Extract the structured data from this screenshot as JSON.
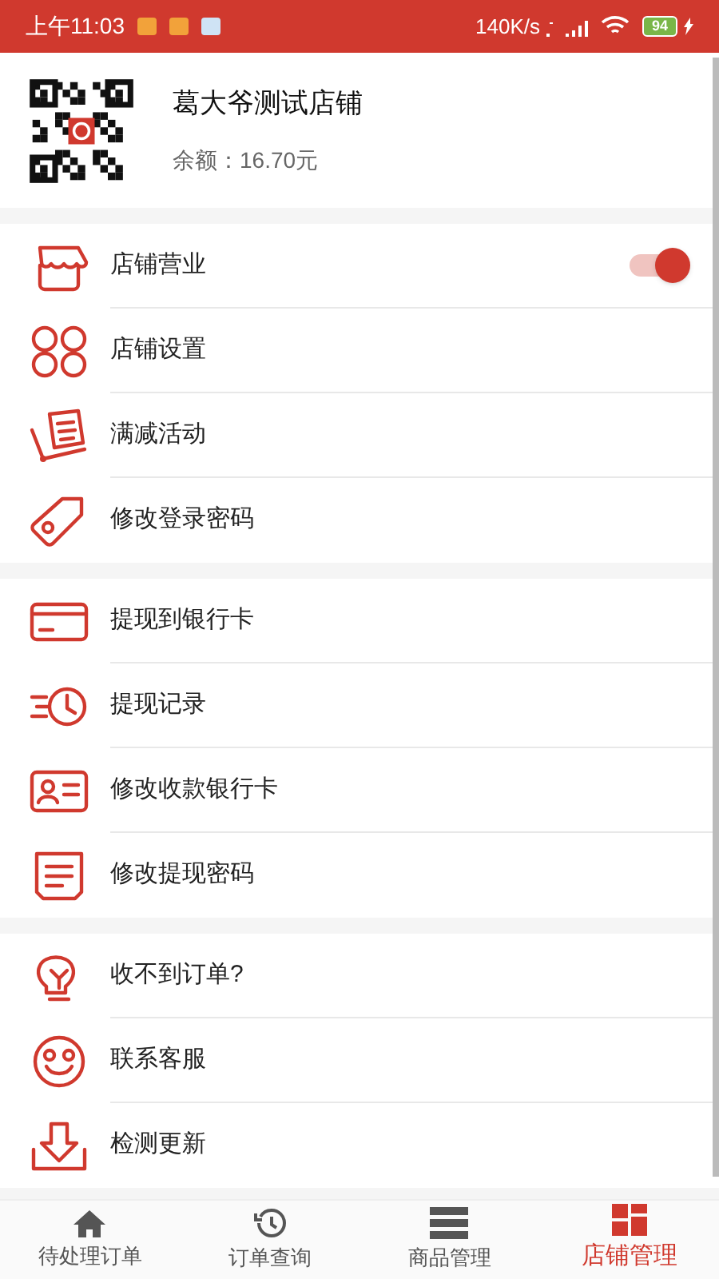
{
  "status_bar": {
    "time": "上午11:03",
    "speed": "140K/s",
    "battery": "94"
  },
  "shop": {
    "name": "葛大爷测试店铺",
    "balance": "余额：16.70元"
  },
  "groups": [
    {
      "items": [
        {
          "label": "店铺营业",
          "kind": "toggle",
          "on": true
        },
        {
          "label": "店铺设置",
          "kind": "link"
        },
        {
          "label": "满减活动",
          "kind": "link"
        },
        {
          "label": "修改登录密码",
          "kind": "link"
        }
      ]
    },
    {
      "items": [
        {
          "label": "提现到银行卡",
          "kind": "link"
        },
        {
          "label": "提现记录",
          "kind": "link"
        },
        {
          "label": "修改收款银行卡",
          "kind": "link"
        },
        {
          "label": "修改提现密码",
          "kind": "link"
        }
      ]
    },
    {
      "items": [
        {
          "label": "收不到订单?",
          "kind": "link"
        },
        {
          "label": "联系客服",
          "kind": "link"
        },
        {
          "label": "检测更新",
          "kind": "link"
        }
      ]
    }
  ],
  "tabs": [
    {
      "label": "待处理订单",
      "selected": false
    },
    {
      "label": "订单查询",
      "selected": false
    },
    {
      "label": "商品管理",
      "selected": false
    },
    {
      "label": "店铺管理",
      "selected": true
    }
  ]
}
